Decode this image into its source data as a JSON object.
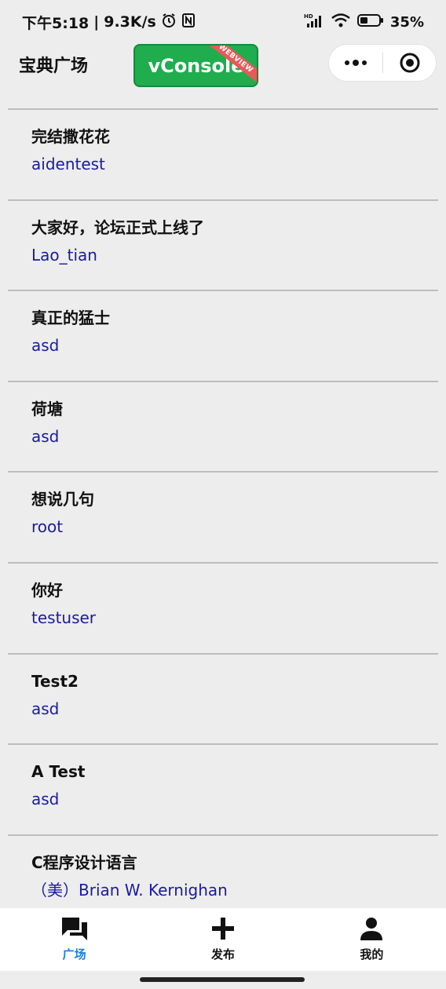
{
  "status_bar": {
    "time": "下午5:18",
    "speed": "9.3K/s",
    "battery_percent": "35%"
  },
  "nav": {
    "title": "宝典广场",
    "vconsole_label": "vConsole",
    "vconsole_ribbon": "WEBVIEW",
    "colors": {
      "vconsole_bg": "#1fad4e",
      "ribbon": "#e65a5a"
    }
  },
  "posts": [
    {
      "title": "完结撒花花",
      "author": "aidentest"
    },
    {
      "title": "大家好，论坛正式上线了",
      "author": "Lao_tian"
    },
    {
      "title": "真正的猛士",
      "author": "asd"
    },
    {
      "title": "荷塘",
      "author": "asd"
    },
    {
      "title": "想说几句",
      "author": "root"
    },
    {
      "title": "你好",
      "author": "testuser"
    },
    {
      "title": "Test2",
      "author": "asd"
    },
    {
      "title": "A Test",
      "author": "asd"
    },
    {
      "title": "C程序设计语言",
      "author": "（美）Brian W. Kernighan"
    }
  ],
  "tabs": [
    {
      "label": "广场",
      "icon": "chat-bubbles-icon",
      "active": true
    },
    {
      "label": "发布",
      "icon": "plus-icon",
      "active": false
    },
    {
      "label": "我的",
      "icon": "person-icon",
      "active": false
    }
  ],
  "colors": {
    "author_link": "#1a1aa6",
    "active_tab": "#1a7ee6"
  }
}
